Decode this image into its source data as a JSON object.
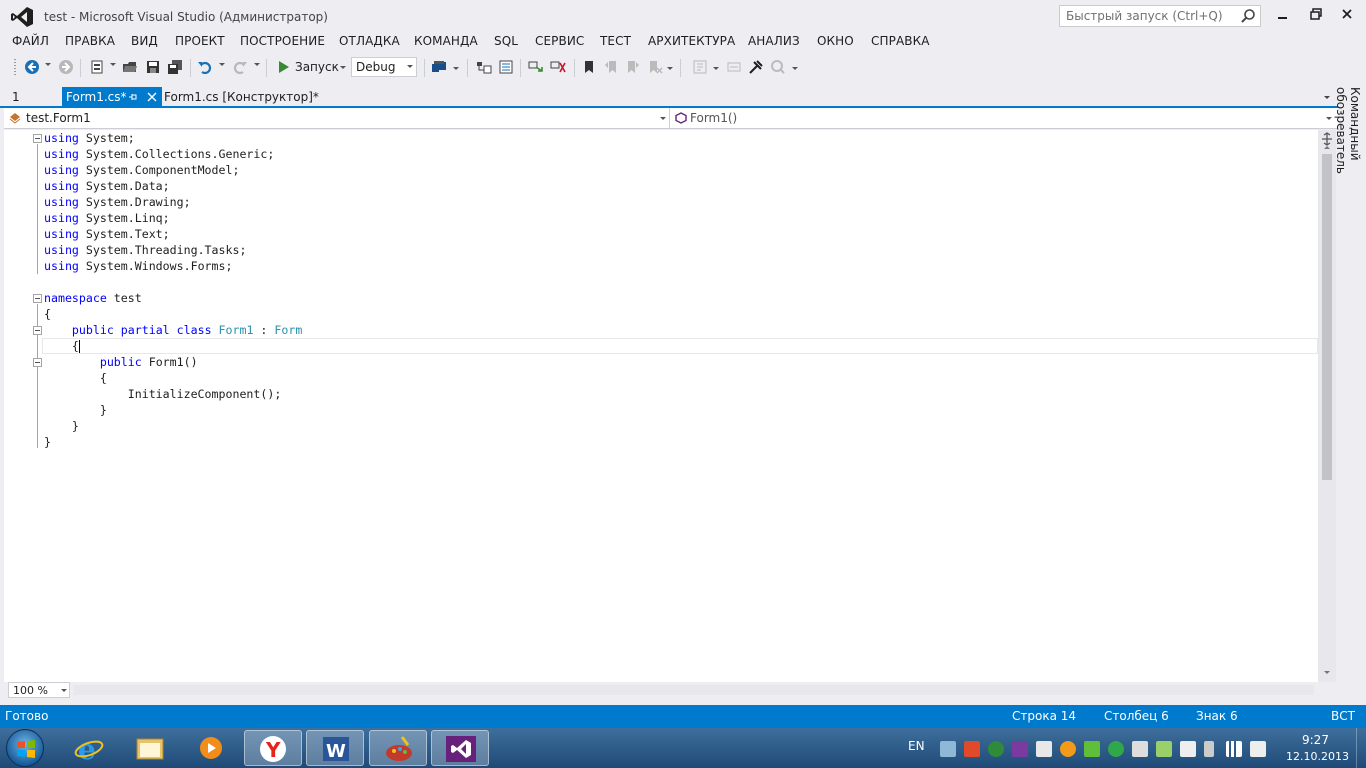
{
  "window": {
    "title": "test - Microsoft Visual Studio (Администратор)",
    "quick_launch_placeholder": "Быстрый запуск (Ctrl+Q)"
  },
  "menu": [
    "ФАЙЛ",
    "ПРАВКА",
    "ВИД",
    "ПРОЕКТ",
    "ПОСТРОЕНИЕ",
    "ОТЛАДКА",
    "КОМАНДА",
    "SQL",
    "СЕРВИС",
    "ТЕСТ",
    "АРХИТЕКТУРА",
    "АНАЛИЗ",
    "ОКНО",
    "СПРАВКА"
  ],
  "toolbar": {
    "run_label": "Запуск",
    "configuration": "Debug"
  },
  "tabs": {
    "left_number": "1",
    "active": "Form1.cs*",
    "inactive": "Form1.cs [Конструктор]*"
  },
  "navbar": {
    "type_name": "test.Form1",
    "member_name": "Form1()"
  },
  "code": {
    "lines": [
      [
        "using",
        " System;"
      ],
      [
        "using",
        " System.Collections.Generic;"
      ],
      [
        "using",
        " System.ComponentModel;"
      ],
      [
        "using",
        " System.Data;"
      ],
      [
        "using",
        " System.Drawing;"
      ],
      [
        "using",
        " System.Linq;"
      ],
      [
        "using",
        " System.Text;"
      ],
      [
        "using",
        " System.Threading.Tasks;"
      ],
      [
        "using",
        " System.Windows.Forms;"
      ]
    ],
    "namespace_kw": "namespace",
    "namespace_name": " test",
    "open_brace": "{",
    "class_line": {
      "indent": "    ",
      "kw1": "public",
      "kw2": "partial",
      "kw3": "class",
      "type1": "Form1",
      "sep": " : ",
      "type2": "Form"
    },
    "class_open": "    {",
    "ctor_line": {
      "indent": "        ",
      "kw": "public",
      "name": " Form1()"
    },
    "ctor_open": "        {",
    "ctor_body": "            InitializeComponent();",
    "ctor_close": "        }",
    "class_close": "    }",
    "ns_close": "}"
  },
  "editor": {
    "zoom": "100 %"
  },
  "side_panel": {
    "label": "Командный обозреватель"
  },
  "status": {
    "ready": "Готово",
    "line": "Строка 14",
    "column": "Столбец 6",
    "char": "Знак 6",
    "mode": "ВСТ"
  },
  "taskbar": {
    "apps": [
      "internet-explorer",
      "explorer",
      "media-player",
      "yandex-browser",
      "word",
      "paint-app",
      "visual-studio"
    ],
    "lang": "EN",
    "time": "9:27",
    "date": "12.10.2013"
  },
  "colors": {
    "accent": "#007acc",
    "keyword": "#0000ff",
    "type": "#2b91af",
    "vs_purple": "#68217a"
  }
}
